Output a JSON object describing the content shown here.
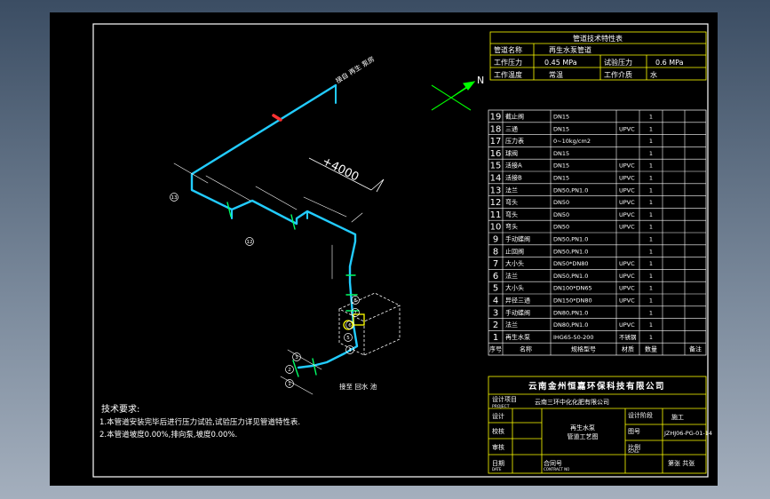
{
  "colors": {
    "background": "#000000",
    "frame": "#ffffff",
    "title_block": "#ffff00",
    "pipe": "#22ccff",
    "text": "#ffffff",
    "label_fill": "#ffff00"
  },
  "spec_table": {
    "title": "管道技术特性表",
    "row1": {
      "label": "管道名称",
      "value": "再生水泵管道"
    },
    "row2": {
      "label": "工作压力",
      "value": "0.45 MPa",
      "label2": "试验压力",
      "value2": "0.6 MPa"
    },
    "row3": {
      "label": "工作温度",
      "value": "常温",
      "label2": "工作介质",
      "value2": "水"
    }
  },
  "north_label": "N",
  "dimension_label": "+4000",
  "pipe_label_top": "接自 再生 泵房",
  "pipe_label_bottom": "接至 回水 池",
  "balloons": [
    "13",
    "12",
    "8",
    "7",
    "6",
    "5",
    "4",
    "3",
    "2",
    "1"
  ],
  "bom": {
    "header": {
      "no": "序号",
      "name": "名称",
      "spec": "规格型号",
      "material": "材质",
      "qty": "数量",
      "remark": "备注"
    },
    "rows": [
      {
        "no": "19",
        "name": "截止阀",
        "spec": "DN15",
        "material": "",
        "qty": "1"
      },
      {
        "no": "18",
        "name": "三通",
        "spec": "DN15",
        "material": "UPVC",
        "qty": "1"
      },
      {
        "no": "17",
        "name": "压力表",
        "spec": "0~10kg/cm2",
        "material": "",
        "qty": "1"
      },
      {
        "no": "16",
        "name": "球阀",
        "spec": "DN15",
        "material": "",
        "qty": "1"
      },
      {
        "no": "15",
        "name": "活接A",
        "spec": "DN15",
        "material": "UPVC",
        "qty": "1"
      },
      {
        "no": "14",
        "name": "活接B",
        "spec": "DN15",
        "material": "UPVC",
        "qty": "1"
      },
      {
        "no": "13",
        "name": "法兰",
        "spec": "DN50,PN1.0",
        "material": "UPVC",
        "qty": "1"
      },
      {
        "no": "12",
        "name": "弯头",
        "spec": "DN50",
        "material": "UPVC",
        "qty": "1"
      },
      {
        "no": "11",
        "name": "弯头",
        "spec": "DN50",
        "material": "UPVC",
        "qty": "1"
      },
      {
        "no": "10",
        "name": "弯头",
        "spec": "DN50",
        "material": "UPVC",
        "qty": "1"
      },
      {
        "no": "9",
        "name": "手动蝶阀",
        "spec": "DN50,PN1.0",
        "material": "",
        "qty": "1"
      },
      {
        "no": "8",
        "name": "止回阀",
        "spec": "DN50,PN1.0",
        "material": "",
        "qty": "1"
      },
      {
        "no": "7",
        "name": "大小头",
        "spec": "DN50*DN80",
        "material": "UPVC",
        "qty": "1"
      },
      {
        "no": "6",
        "name": "法兰",
        "spec": "DN50,PN1.0",
        "material": "UPVC",
        "qty": "1"
      },
      {
        "no": "5",
        "name": "大小头",
        "spec": "DN100*DN65",
        "material": "UPVC",
        "qty": "1"
      },
      {
        "no": "4",
        "name": "异径三通",
        "spec": "DN150*DN80",
        "material": "UPVC",
        "qty": "1"
      },
      {
        "no": "3",
        "name": "手动蝶阀",
        "spec": "DN80,PN1.0",
        "material": "",
        "qty": "1"
      },
      {
        "no": "2",
        "name": "法兰",
        "spec": "DN80,PN1.0",
        "material": "UPVC",
        "qty": "1"
      },
      {
        "no": "1",
        "name": "再生水泵",
        "spec": "IHG65-50-200",
        "material": "不锈钢",
        "qty": "1"
      }
    ]
  },
  "title_block": {
    "company": "云南金州恒嘉环保科技有限公司",
    "project_label": "设计项目",
    "project_label_en": "PROJECT",
    "project": "云南三环中化化肥有限公司",
    "design_label": "设计",
    "check_label": "校核",
    "audit_label": "审核",
    "drawing_name": "再生水泵",
    "drawing_name2": "管道工艺图",
    "stage_label": "设计阶段",
    "stage": "施工",
    "drawing_no_label": "图号",
    "drawing_no": "JZHJ06-PG-01-14",
    "scale_label": "比例",
    "scale_label_en": "SCALE",
    "sheet_label": "第张 共张",
    "date_label": "日期",
    "date_label_en": "DATE",
    "contract_label": "合同号",
    "contract_label_en": "CONTRACT NO"
  },
  "notes": {
    "title": "技术要求:",
    "line1": "1.本管道安装完毕后进行压力试验,试验压力详见管道特性表.",
    "line2": "2.本管道坡度0.00%,排向泵,坡度0.00%."
  }
}
